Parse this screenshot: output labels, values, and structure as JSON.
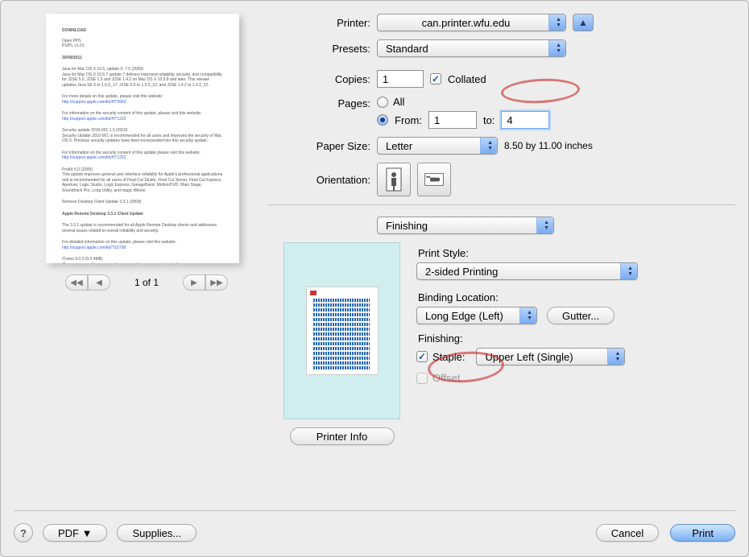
{
  "preview": {
    "nav_label": "1 of 1"
  },
  "labels": {
    "printer": "Printer:",
    "presets": "Presets:",
    "copies": "Copies:",
    "pages": "Pages:",
    "all": "All",
    "from": "From:",
    "to": "to:",
    "paper_size": "Paper Size:",
    "orientation": "Orientation:",
    "collated": "Collated",
    "print_style": "Print Style:",
    "binding_location": "Binding Location:",
    "gutter": "Gutter...",
    "finishing_section": "Finishing:",
    "staple": "Staple:",
    "offset": "Offset",
    "printer_info": "Printer Info",
    "pdf": "PDF ▼",
    "supplies": "Supplies...",
    "cancel": "Cancel",
    "print": "Print",
    "help": "?"
  },
  "values": {
    "printer": "can.printer.wfu.edu",
    "presets": "Standard",
    "copies": "1",
    "collated": true,
    "pages_mode": "from",
    "page_from": "1",
    "page_to": "4",
    "paper_size": "Letter",
    "paper_dims": "8.50 by 11.00 inches",
    "feature_section": "Finishing",
    "print_style": "2-sided Printing",
    "binding_location": "Long Edge (Left)",
    "staple_checked": true,
    "staple_option": "Upper Left (Single)",
    "offset_checked": false,
    "offset_enabled": false
  }
}
